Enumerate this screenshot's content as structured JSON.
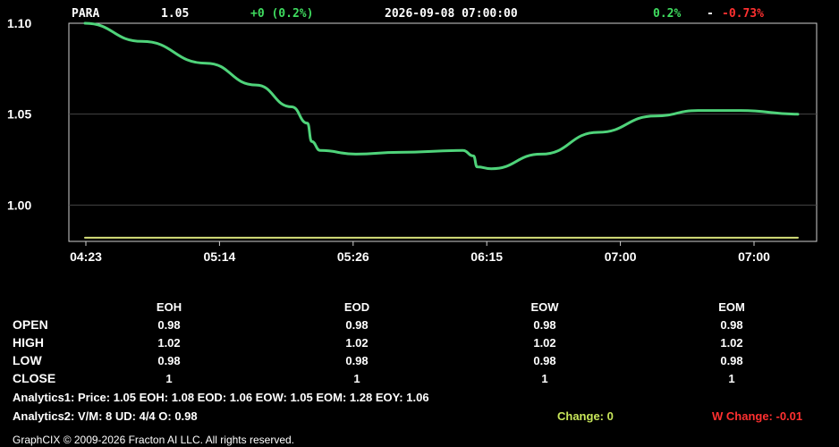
{
  "header": {
    "symbol": "PARA",
    "price": "1.05",
    "change": "+0 (0.2%)",
    "datetime": "2026-09-08  07:00:00",
    "pct_up": "0.2%",
    "sep": "-",
    "pct_down": "-0.73%"
  },
  "chart_data": {
    "type": "line",
    "x_tick_labels": [
      "04:23",
      "05:14",
      "05:26",
      "06:15",
      "07:00",
      "07:00"
    ],
    "y_tick_labels": [
      "1.10",
      "1.05",
      "1.00"
    ],
    "ylim": [
      0.98,
      1.1
    ],
    "grid": true,
    "series": [
      {
        "color": "#4fd37a",
        "points": [
          [
            0,
            1.1
          ],
          [
            0.08,
            1.09
          ],
          [
            0.17,
            1.078
          ],
          [
            0.24,
            1.066
          ],
          [
            0.29,
            1.054
          ],
          [
            0.312,
            1.045
          ],
          [
            0.318,
            1.035
          ],
          [
            0.33,
            1.03
          ],
          [
            0.38,
            1.028
          ],
          [
            0.44,
            1.029
          ],
          [
            0.53,
            1.03
          ],
          [
            0.545,
            1.027
          ],
          [
            0.55,
            1.021
          ],
          [
            0.57,
            1.02
          ],
          [
            0.64,
            1.028
          ],
          [
            0.72,
            1.04
          ],
          [
            0.8,
            1.049
          ],
          [
            0.86,
            1.052
          ],
          [
            0.92,
            1.052
          ],
          [
            1.0,
            1.05
          ]
        ]
      },
      {
        "color": "#d6e07a",
        "points": [
          [
            0,
            0.982
          ],
          [
            1.0,
            0.982
          ]
        ]
      }
    ]
  },
  "table": {
    "columns": [
      "EOH",
      "EOD",
      "EOW",
      "EOM"
    ],
    "rows": [
      {
        "label": "OPEN",
        "values": [
          "0.98",
          "0.98",
          "0.98",
          "0.98"
        ]
      },
      {
        "label": "HIGH",
        "values": [
          "1.02",
          "1.02",
          "1.02",
          "1.02"
        ]
      },
      {
        "label": "LOW",
        "values": [
          "0.98",
          "0.98",
          "0.98",
          "0.98"
        ]
      },
      {
        "label": "CLOSE",
        "values": [
          "1",
          "1",
          "1",
          "1"
        ]
      }
    ]
  },
  "analytics1": "Analytics1: Price: 1.05    EOH: 1.08    EOD: 1.06    EOW: 1.05    EOM: 1.28    EOY: 1.06",
  "analytics2": "Analytics2:  V/M: 8    UD: 4/4    O: 0.98",
  "change": "Change: 0",
  "w_change": "W Change: -0.01",
  "footer": "GraphCIX © 2009-2026 Fracton AI LLC. All rights reserved.",
  "colors": {
    "up": "#3fdc5f",
    "down": "#ff3030",
    "change": "#c8e65a"
  }
}
